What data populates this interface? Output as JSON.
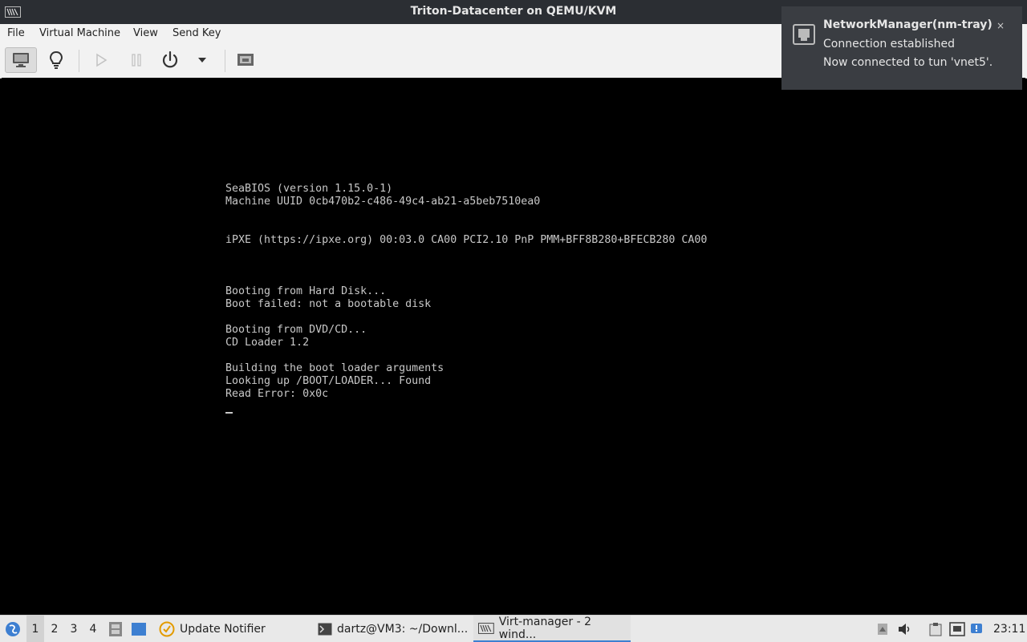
{
  "window": {
    "title": "Triton-Datacenter on QEMU/KVM",
    "icon": "virt-manager-icon"
  },
  "menubar": {
    "items": [
      "File",
      "Virtual Machine",
      "View",
      "Send Key"
    ]
  },
  "toolbar": {
    "buttons": [
      "console-view-icon",
      "details-lightbulb-icon",
      "run-icon",
      "pause-icon",
      "power-icon",
      "dropdown-arrow-icon",
      "fullscreen-icon"
    ],
    "active": "console-view-icon"
  },
  "console": {
    "lines": [
      "SeaBIOS (version 1.15.0-1)",
      "Machine UUID 0cb470b2-c486-49c4-ab21-a5beb7510ea0",
      "",
      "",
      "iPXE (https://ipxe.org) 00:03.0 CA00 PCI2.10 PnP PMM+BFF8B280+BFECB280 CA00",
      "",
      "",
      "",
      "Booting from Hard Disk...",
      "Boot failed: not a bootable disk",
      "",
      "Booting from DVD/CD...",
      "CD Loader 1.2",
      "",
      "Building the boot loader arguments",
      "Looking up /BOOT/LOADER... Found",
      "Read Error: 0x0c"
    ],
    "text_color": "#c8c8c8"
  },
  "notification": {
    "title": "NetworkManager(nm-tray)",
    "line1": "Connection established",
    "line2": "Now connected to tun 'vnet5'.",
    "close": "×",
    "icon": "network-wired-icon"
  },
  "taskbar": {
    "desktops": [
      "1",
      "2",
      "3",
      "4"
    ],
    "current_desktop": "1",
    "tasks": [
      {
        "label": "Update Notifier",
        "icon": "update-notifier-icon"
      },
      {
        "label": "dartz@VM3: ~/Downl...",
        "icon": "terminal-icon"
      },
      {
        "label": "Virt-manager - 2 wind...",
        "icon": "virt-manager-icon"
      }
    ],
    "clock": "23:11",
    "tray_icons": [
      "updates-icon",
      "volume-icon",
      "clipboard-icon",
      "network-icon",
      "notifications-icon"
    ]
  },
  "accent": "#3d7fd1"
}
